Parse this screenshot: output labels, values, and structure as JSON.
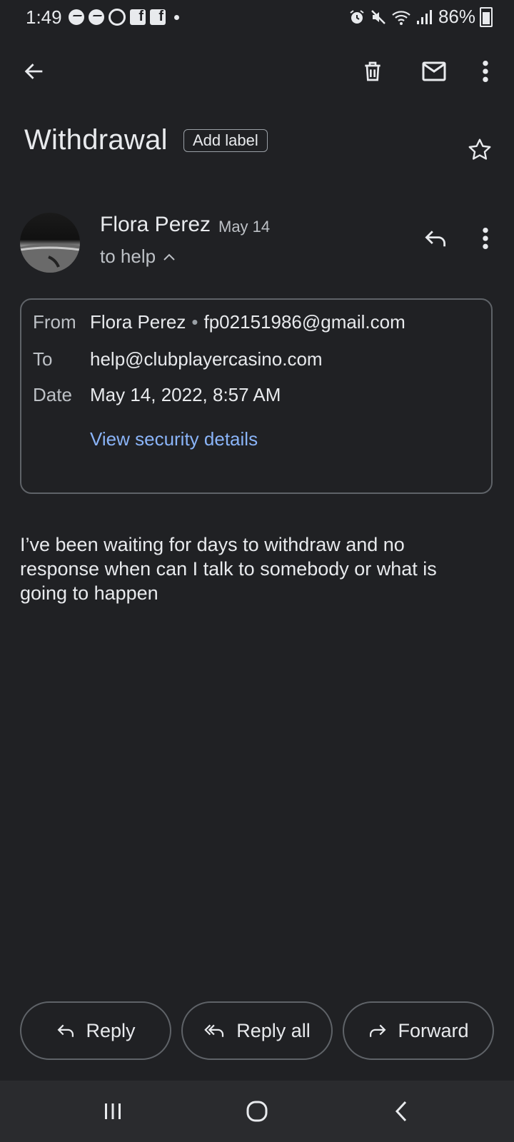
{
  "status_bar": {
    "time": "1:49",
    "battery_text": "86%",
    "left_icons": [
      "messenger-icon",
      "messenger-icon",
      "threads-icon",
      "facebook-icon",
      "facebook-icon",
      "dot-icon"
    ],
    "right_icons": [
      "alarm-icon",
      "mute-icon",
      "wifi-icon",
      "signal-icon",
      "battery-charging-icon"
    ]
  },
  "toolbar": {
    "icons": [
      "back-arrow-icon",
      "delete-icon",
      "mark-unread-icon",
      "more-vert-icon"
    ]
  },
  "email": {
    "subject": "Withdrawal",
    "add_label": "Add label",
    "sender_name": "Flora Perez",
    "short_date": "May 14",
    "to_summary": "to help",
    "details": {
      "from_key": "From",
      "from_name": "Flora Perez",
      "from_sep": "•",
      "from_email": "fp02151986@gmail.com",
      "to_key": "To",
      "to_email": "help@clubplayercasino.com",
      "date_key": "Date",
      "date_value": "May 14, 2022, 8:57 AM",
      "security_link": "View security details"
    },
    "body": "I’ve been waiting for days to withdraw and no response when can I talk to somebody or what is going to happen"
  },
  "actions": {
    "reply": "Reply",
    "reply_all": "Reply all",
    "forward": "Forward"
  },
  "colors": {
    "background": "#202124",
    "text": "#e8eaed",
    "secondary_text": "#bdc1c6",
    "link": "#8ab4f8",
    "border": "#5f6368",
    "nav_bar": "#2a2b2e"
  }
}
